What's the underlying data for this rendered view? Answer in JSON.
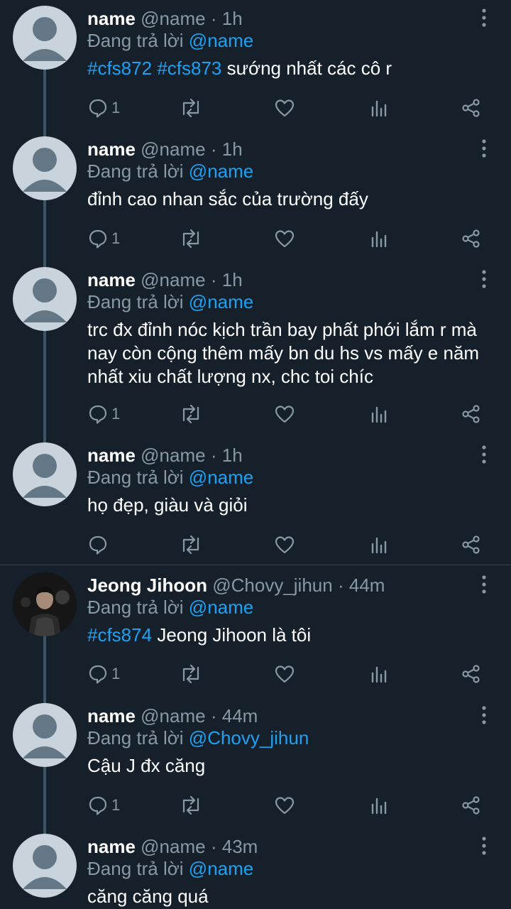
{
  "colors": {
    "background": "#15202b",
    "accent": "#1da1f2",
    "muted": "#8899a6",
    "thread_line": "#3d5466"
  },
  "tweets": [
    {
      "name": "name",
      "handle": "@name",
      "dot": "·",
      "time": "1h",
      "replying_prefix": "Đang trả lời",
      "replying_to": "@name",
      "hashtags": [
        "#cfs872",
        "#cfs873"
      ],
      "text": "sướng nhất các cô r",
      "reply_count": "1",
      "avatar": "default-avatar-icon"
    },
    {
      "name": "name",
      "handle": "@name",
      "dot": "·",
      "time": "1h",
      "replying_prefix": "Đang trả lời",
      "replying_to": "@name",
      "text": "đỉnh cao nhan sắc của trường đấy",
      "reply_count": "1",
      "avatar": "default-avatar-icon"
    },
    {
      "name": "name",
      "handle": "@name",
      "dot": "·",
      "time": "1h",
      "replying_prefix": "Đang trả lời",
      "replying_to": "@name",
      "text_lines": [
        "trc đx đỉnh nóc kịch trần bay phất phới lắm r mà",
        "nay còn cộng thêm mấy bn du hs vs mấy e năm",
        "nhất xiu chất lượng nx, chc toi chíc"
      ],
      "reply_count": "1",
      "avatar": "default-avatar-icon"
    },
    {
      "name": "name",
      "handle": "@name",
      "dot": "·",
      "time": "1h",
      "replying_prefix": "Đang trả lời",
      "replying_to": "@name",
      "text": "họ đẹp, giàu và giỏi",
      "reply_count": "",
      "avatar": "default-avatar-icon"
    },
    {
      "name": "Jeong Jihoon",
      "handle": "@Chovy_jihun",
      "dot": "·",
      "time": "44m",
      "replying_prefix": "Đang trả lời",
      "replying_to": "@name",
      "hashtags": [
        "#cfs874"
      ],
      "text": "Jeong Jihoon là tôi",
      "reply_count": "1",
      "avatar": "profile-photo-avatar"
    },
    {
      "name": "name",
      "handle": "@name",
      "dot": "·",
      "time": "44m",
      "replying_prefix": "Đang trả lời",
      "replying_to": "@Chovy_jihun",
      "text": "Cậu J đx căng",
      "reply_count": "1",
      "avatar": "default-avatar-icon"
    },
    {
      "name": "name",
      "handle": "@name",
      "dot": "·",
      "time": "43m",
      "replying_prefix": "Đang trả lời",
      "replying_to": "@name",
      "text": "căng căng quá",
      "avatar": "default-avatar-icon"
    }
  ]
}
